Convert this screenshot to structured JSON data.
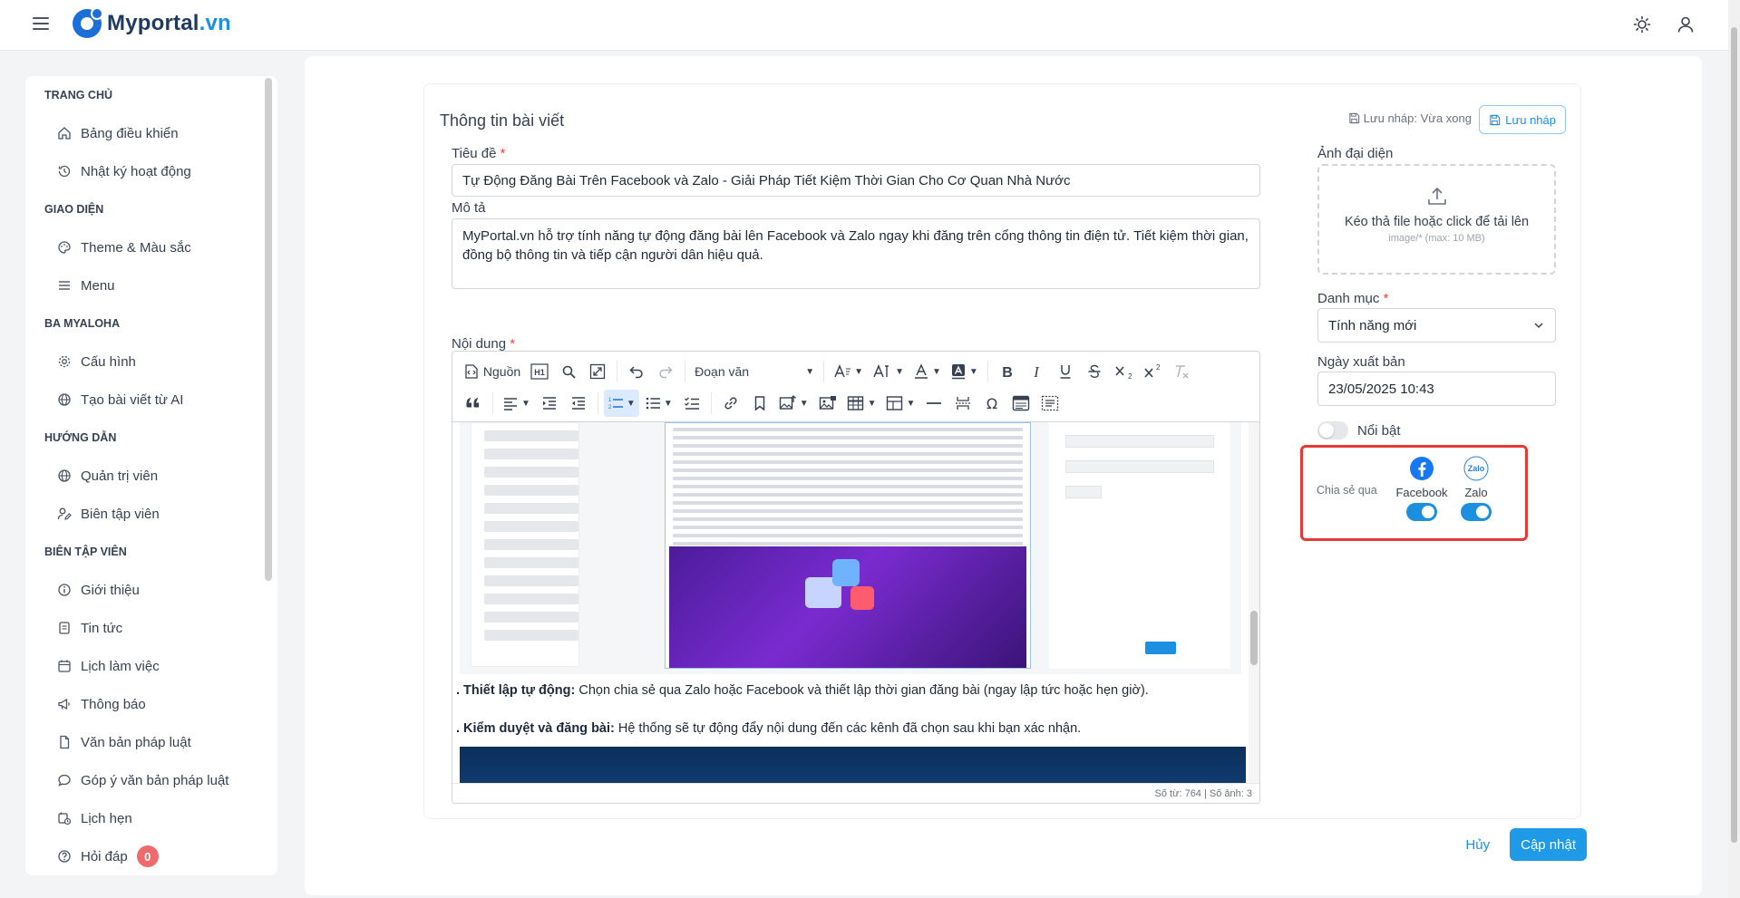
{
  "header": {
    "brand_name": "Myportal",
    "brand_tld": ".vn",
    "icons": [
      "menu-icon",
      "sun-icon",
      "user-icon"
    ]
  },
  "sidebar": {
    "sections": [
      {
        "title": "TRANG CHỦ",
        "items": [
          {
            "label": "Bảng điều khiển",
            "icon": "home-icon"
          },
          {
            "label": "Nhật ký hoạt động",
            "icon": "history-icon"
          }
        ]
      },
      {
        "title": "GIAO DIỆN",
        "items": [
          {
            "label": "Theme & Màu sắc",
            "icon": "palette-icon"
          },
          {
            "label": "Menu",
            "icon": "list-icon"
          }
        ]
      },
      {
        "title": "BA MYALOHA",
        "items": [
          {
            "label": "Cấu hình",
            "icon": "gear-icon"
          },
          {
            "label": "Tạo bài viết từ AI",
            "icon": "globe-icon"
          }
        ]
      },
      {
        "title": "HƯỚNG DẪN",
        "items": [
          {
            "label": "Quản trị viên",
            "icon": "globe-icon"
          },
          {
            "label": "Biên tập viên",
            "icon": "user-edit-icon"
          }
        ]
      },
      {
        "title": "BIÊN TẬP VIÊN",
        "items": [
          {
            "label": "Giới thiệu",
            "icon": "info-icon"
          },
          {
            "label": "Tin tức",
            "icon": "news-icon"
          },
          {
            "label": "Lịch làm việc",
            "icon": "calendar-icon"
          },
          {
            "label": "Thông báo",
            "icon": "megaphone-icon"
          },
          {
            "label": "Văn bản pháp luật",
            "icon": "document-icon"
          },
          {
            "label": "Góp ý văn bản pháp luật",
            "icon": "comment-icon"
          },
          {
            "label": "Lịch hẹn",
            "icon": "calendar-clock-icon"
          },
          {
            "label": "Hỏi đáp",
            "icon": "help-icon",
            "badge": "0"
          }
        ]
      }
    ]
  },
  "form": {
    "card_title": "Thông tin bài viết",
    "draft_status": "Lưu nháp: Vừa xong",
    "draft_button": "Lưu nháp",
    "title_label": "Tiêu đề",
    "required_mark": "*",
    "title_value": "Tự Động Đăng Bài Trên Facebook và Zalo - Giải Pháp Tiết Kiệm Thời Gian Cho Cơ Quan Nhà Nước",
    "desc_label": "Mô tả",
    "desc_value": "MyPortal.vn hỗ trợ tính năng tự động đăng bài lên Facebook và Zalo ngay khi đăng trên cổng thông tin điện tử. Tiết kiệm thời gian, đồng bộ thông tin và tiếp cận người dân hiệu quả.",
    "content_label": "Nội dung",
    "toolbar": {
      "source": "Nguồn",
      "paragraph": "Đoạn văn"
    },
    "content": {
      "p1_bold": ". Thiết lập tự động:",
      "p1_text": " Chọn chia sẻ qua Zalo hoặc Facebook và thiết lập thời gian đăng bài (ngay lập tức hoặc hẹn giờ).",
      "p2_bold": ". Kiểm duyệt và đăng bài:",
      "p2_text": " Hệ thống sẽ tự động đẩy nội dung đến các kênh đã chọn sau khi bạn xác nhận."
    },
    "status_bar": "Số từ: 764 | Số ảnh: 3",
    "avatar_label": "Ảnh đại diện",
    "upload_text": "Kéo thả file hoặc click để tải lên",
    "upload_hint": "image/* (max: 10 MB)",
    "category_label": "Danh mục",
    "category_value": "Tính năng mới",
    "publish_label": "Ngày xuất bản",
    "publish_value": "23/05/2025 10:43",
    "featured_label": "Nổi bật",
    "featured_on": false,
    "share_label": "Chia sẻ qua",
    "share_facebook": "Facebook",
    "share_zalo": "Zalo",
    "zalo_logo_text": "Zalo",
    "facebook_on": true,
    "zalo_on": true,
    "cancel_button": "Hủy",
    "submit_button": "Cập nhật"
  },
  "colors": {
    "accent": "#1d8fe0",
    "highlight": "#e53935",
    "badge": "#ef6a6a"
  }
}
